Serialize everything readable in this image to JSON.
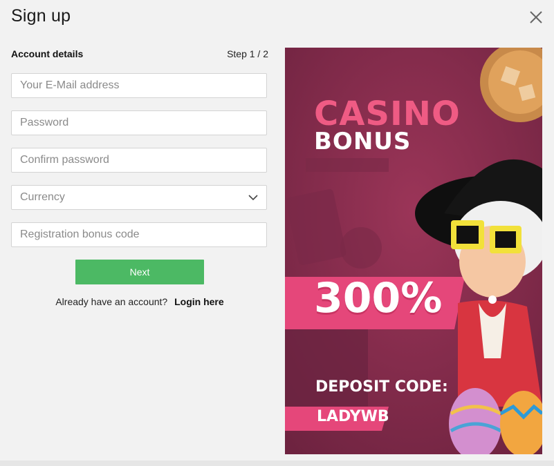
{
  "modal": {
    "title": "Sign up",
    "close_icon": "close-icon"
  },
  "form": {
    "section_title": "Account details",
    "step": "Step 1 / 2",
    "email_placeholder": "Your E-Mail address",
    "password_placeholder": "Password",
    "confirm_placeholder": "Confirm password",
    "currency_placeholder": "Currency",
    "bonus_code_placeholder": "Registration bonus code",
    "next_label": "Next",
    "login_prompt": "Already have an account?",
    "login_link": "Login here"
  },
  "promo": {
    "line1": "CASINO",
    "line2": "BONUS",
    "percent": "300%",
    "deposit_label": "DEPOSIT CODE:",
    "code": "LADYWB"
  },
  "colors": {
    "accent_green": "#4cb964",
    "promo_bg": "#8a2f4d",
    "promo_pink": "#ef5b84"
  }
}
